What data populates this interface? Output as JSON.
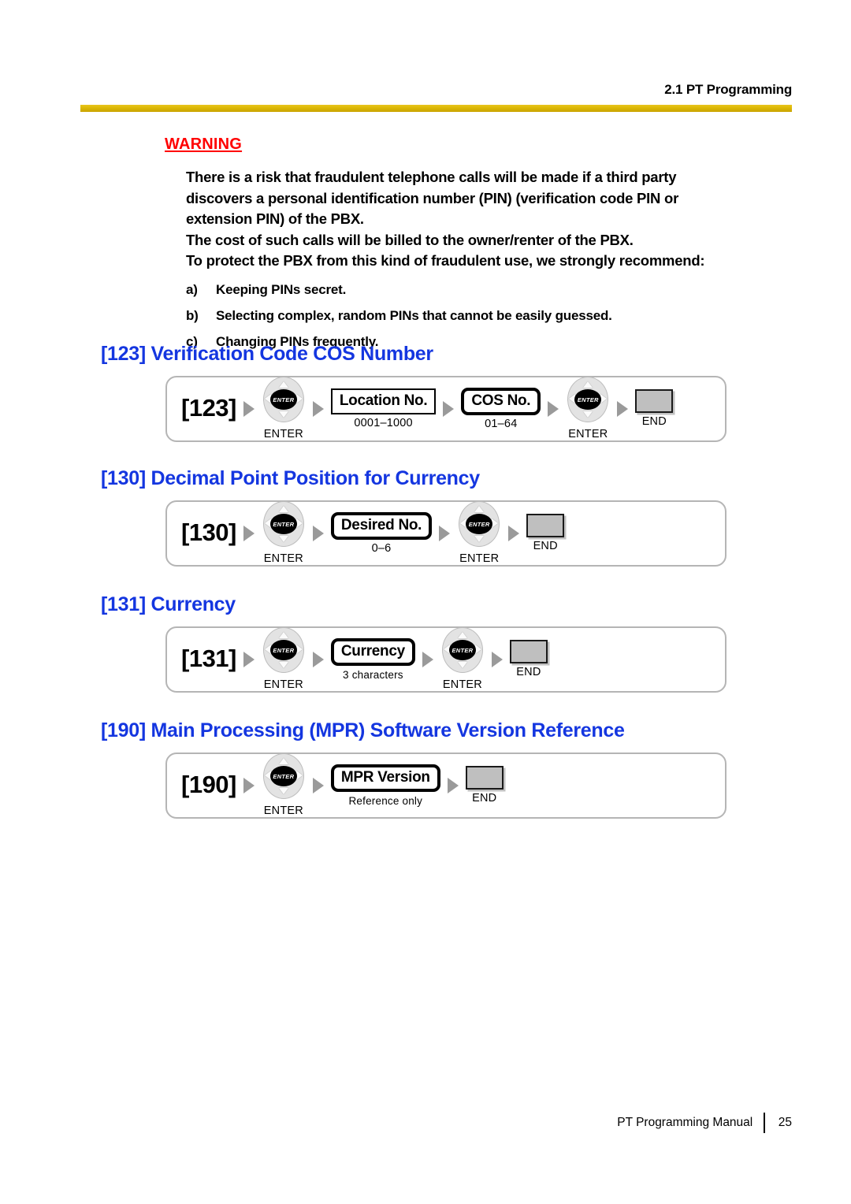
{
  "header": {
    "section_ref": "2.1 PT Programming",
    "rule_color": "#dcb806"
  },
  "warning": {
    "title": "WARNING",
    "title_color": "#ff0000",
    "paragraphs": [
      "There is a risk that fraudulent telephone calls will be made if a third party",
      "discovers a personal identification number (PIN) (verification code PIN or",
      "extension PIN) of the PBX.",
      "The cost of such calls will be billed to the owner/renter of the PBX.",
      "To protect the PBX from this kind of fraudulent use, we strongly recommend:"
    ],
    "recommendations": [
      {
        "marker": "a)",
        "text": "Keeping PINs secret."
      },
      {
        "marker": "b)",
        "text": "Selecting complex, random PINs that cannot be easily guessed."
      },
      {
        "marker": "c)",
        "text": "Changing PINs frequently."
      }
    ]
  },
  "heading_color": "#1436e0",
  "sections": [
    {
      "title": "[123] Verification Code COS Number",
      "flow": {
        "code": "[123]",
        "steps": [
          {
            "type": "nav",
            "center_label": "ENTER",
            "caption": "ENTER"
          },
          {
            "type": "entry",
            "style": "thin",
            "label": "Location No.",
            "caption": "0001–1000"
          },
          {
            "type": "entry",
            "style": "thick",
            "label": "COS No.",
            "caption": "01–64"
          },
          {
            "type": "nav",
            "center_label": "ENTER",
            "caption": "ENTER"
          },
          {
            "type": "end",
            "caption": "END"
          }
        ]
      }
    },
    {
      "title": "[130] Decimal Point Position for Currency",
      "flow": {
        "code": "[130]",
        "steps": [
          {
            "type": "nav",
            "center_label": "ENTER",
            "caption": "ENTER"
          },
          {
            "type": "entry",
            "style": "thick",
            "label": "Desired No.",
            "caption": "0–6"
          },
          {
            "type": "nav",
            "center_label": "ENTER",
            "caption": "ENTER"
          },
          {
            "type": "end",
            "caption": "END"
          }
        ]
      }
    },
    {
      "title": "[131] Currency",
      "flow": {
        "code": "[131]",
        "steps": [
          {
            "type": "nav",
            "center_label": "ENTER",
            "caption": "ENTER"
          },
          {
            "type": "entry",
            "style": "thick",
            "label": "Currency",
            "caption": "3 characters"
          },
          {
            "type": "nav",
            "center_label": "ENTER",
            "caption": "ENTER"
          },
          {
            "type": "end",
            "caption": "END"
          }
        ]
      }
    },
    {
      "title": "[190] Main Processing (MPR) Software Version Reference",
      "flow": {
        "code": "[190]",
        "steps": [
          {
            "type": "nav",
            "center_label": "ENTER",
            "caption": "ENTER"
          },
          {
            "type": "entry",
            "style": "thick",
            "label": "MPR Version",
            "caption": "Reference only"
          },
          {
            "type": "end",
            "caption": "END"
          }
        ]
      }
    }
  ],
  "footer": {
    "manual_title": "PT Programming Manual",
    "page_number": "25"
  }
}
